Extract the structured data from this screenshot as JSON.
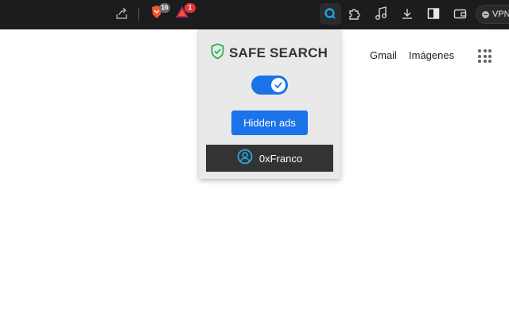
{
  "toolbar": {
    "brave_shield_count": "16",
    "brave_rewards_count": "1",
    "vpn_label": "VPN",
    "colors": {
      "background": "#1c1c1c",
      "brave_orange": "#fb542b",
      "badge_grey": "#6b6b6b",
      "extension_blue": "#1aa3e8"
    },
    "icons": [
      "share-icon",
      "brave-shield-icon",
      "brave-rewards-icon",
      "safe-search-extension-icon",
      "extensions-puzzle-icon",
      "music-icon",
      "download-icon",
      "sidebar-icon",
      "wallet-icon"
    ]
  },
  "google": {
    "gmail_label": "Gmail",
    "images_label": "Imágenes"
  },
  "popup": {
    "title": "SAFE SEARCH",
    "toggle_on": true,
    "hidden_ads_label": "Hidden ads",
    "username": "0xFranco",
    "colors": {
      "accent": "#1a73e8",
      "shield_green": "#2bb24c",
      "user_icon": "#29a8e0",
      "panel": "#e9e9e9",
      "user_bar": "#333333"
    }
  }
}
